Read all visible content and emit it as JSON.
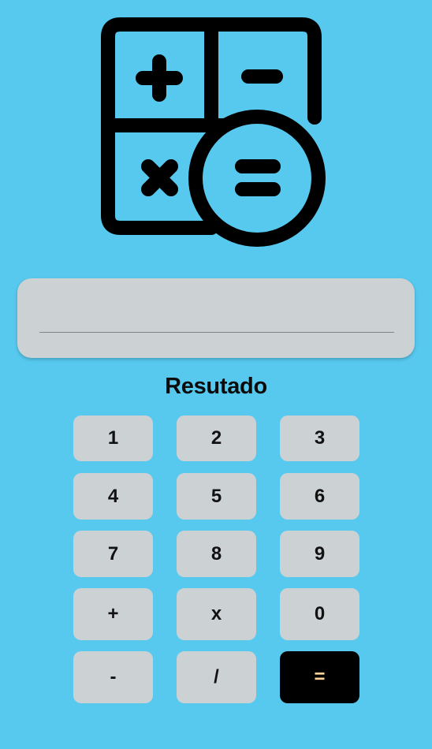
{
  "app": {
    "logo_icon": "calculator-operations-icon",
    "background_color": "#57c9ef"
  },
  "display": {
    "value": "",
    "placeholder": ""
  },
  "result": {
    "label": "Resutado"
  },
  "keypad": {
    "keys": [
      "1",
      "2",
      "3",
      "4",
      "5",
      "6",
      "7",
      "8",
      "9",
      "+",
      "x",
      "0",
      "-",
      "/",
      "="
    ],
    "key_color": "#ccd1d4",
    "equals_color": "#000000",
    "equals_text_color": "#ffd59a"
  }
}
